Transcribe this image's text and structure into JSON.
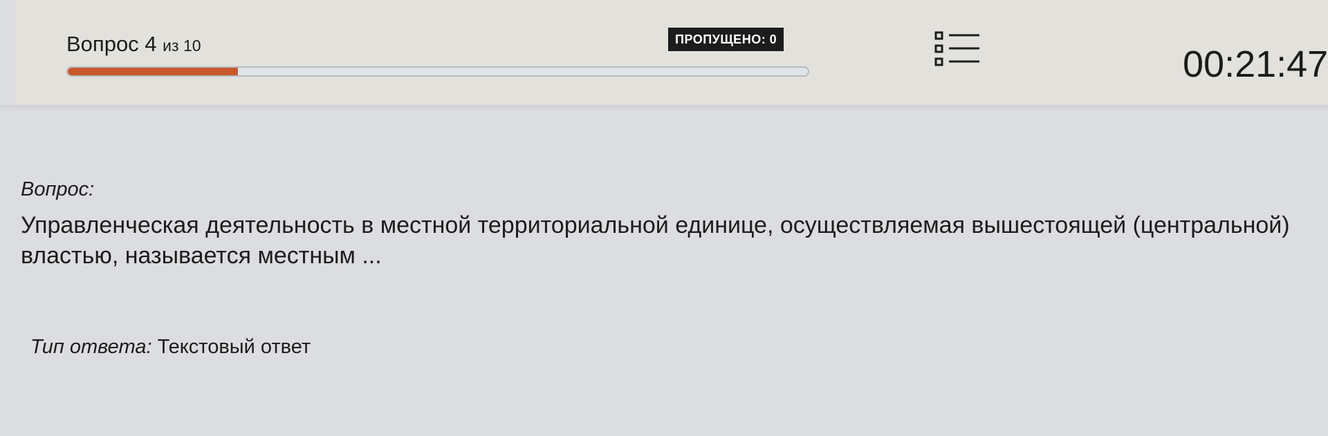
{
  "header": {
    "question_word": "Вопрос 4",
    "question_of": "из 10",
    "skipped": "ПРОПУЩЕНО: 0",
    "timer": "00:21:47",
    "progress_fraction": 0.23,
    "accent_color": "#c8582b"
  },
  "icons": {
    "question_list": "list-icon"
  },
  "question": {
    "label": "Вопрос:",
    "text": "Управленческая деятельность в местной территориальной единице, осуществляемая вышестоящей (центральной)\nвластью, называется местным ..."
  },
  "answer_type": {
    "label": "Тип ответа:",
    "value": "Текстовый ответ"
  }
}
